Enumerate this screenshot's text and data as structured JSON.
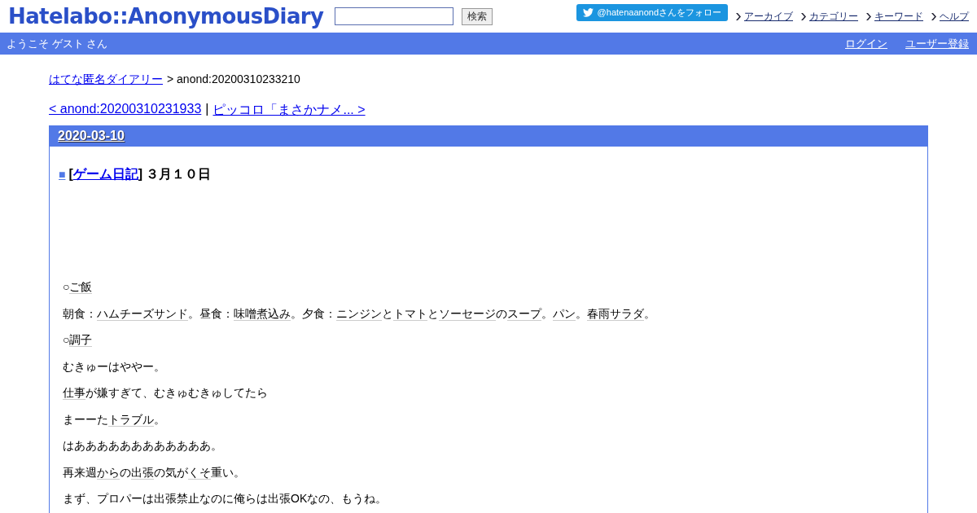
{
  "logo": "Hatelabo::AnonymousDiary",
  "search": {
    "button": "検索"
  },
  "follow_button": "@hatenaanondさんをフォロー",
  "nav_links": [
    "アーカイブ",
    "カテゴリー",
    "キーワード",
    "ヘルプ"
  ],
  "user_bar": {
    "greeting": "ようこそ ゲスト さん",
    "links": [
      "ログイン",
      "ユーザー登録"
    ]
  },
  "breadcrumb": {
    "home": "はてな匿名ダイアリー",
    "separator": ">",
    "current": "anond:20200310233210"
  },
  "pager": {
    "prev": "< anond:20200310231933",
    "separator": "|",
    "next": "ピッコロ「まさかナメ... >"
  },
  "day": {
    "date": "2020-03-10",
    "entry": {
      "mark": "■",
      "category_open": "[",
      "category": "ゲーム日記",
      "category_close": "]",
      "title": "３月１０日",
      "paragraphs": [
        [
          {
            "text": "○"
          },
          {
            "text": "ご飯",
            "keyword": true
          }
        ],
        [
          {
            "text": "朝食："
          },
          {
            "text": "ハムチーズサンド",
            "keyword": true
          },
          {
            "text": "。昼食："
          },
          {
            "text": "味噌煮込み",
            "keyword": true
          },
          {
            "text": "。夕食："
          },
          {
            "text": "ニンジン",
            "keyword": true
          },
          {
            "text": "と"
          },
          {
            "text": "トマト",
            "keyword": true
          },
          {
            "text": "と"
          },
          {
            "text": "ソーセージ",
            "keyword": true
          },
          {
            "text": "の"
          },
          {
            "text": "スープ",
            "keyword": true
          },
          {
            "text": "。"
          },
          {
            "text": "パン",
            "keyword": true
          },
          {
            "text": "。"
          },
          {
            "text": "春雨サラダ",
            "keyword": true
          },
          {
            "text": "。"
          }
        ],
        [
          {
            "text": "○"
          },
          {
            "text": "調子",
            "keyword": true
          }
        ],
        [
          {
            "text": "むきゅーはややー。"
          }
        ],
        [
          {
            "text": "仕事",
            "keyword": true
          },
          {
            "text": "が嫌すぎて、むきゅむきゅしてたら"
          }
        ],
        [
          {
            "text": "まーーた"
          },
          {
            "text": "トラブル",
            "keyword": true
          },
          {
            "text": "。"
          }
        ],
        [
          {
            "text": "はああああああああああああ。"
          }
        ],
        [
          {
            "text": "再来週"
          },
          {
            "text": "から",
            "keyword": true
          },
          {
            "text": "の"
          },
          {
            "text": "出張",
            "keyword": true
          },
          {
            "text": "の気が"
          },
          {
            "text": "くそ",
            "keyword": true
          },
          {
            "text": "重い。"
          }
        ],
        [
          {
            "text": "まず、プロパーは出張禁止なのに俺らは出張OKなの、もうね。"
          }
        ]
      ]
    }
  }
}
